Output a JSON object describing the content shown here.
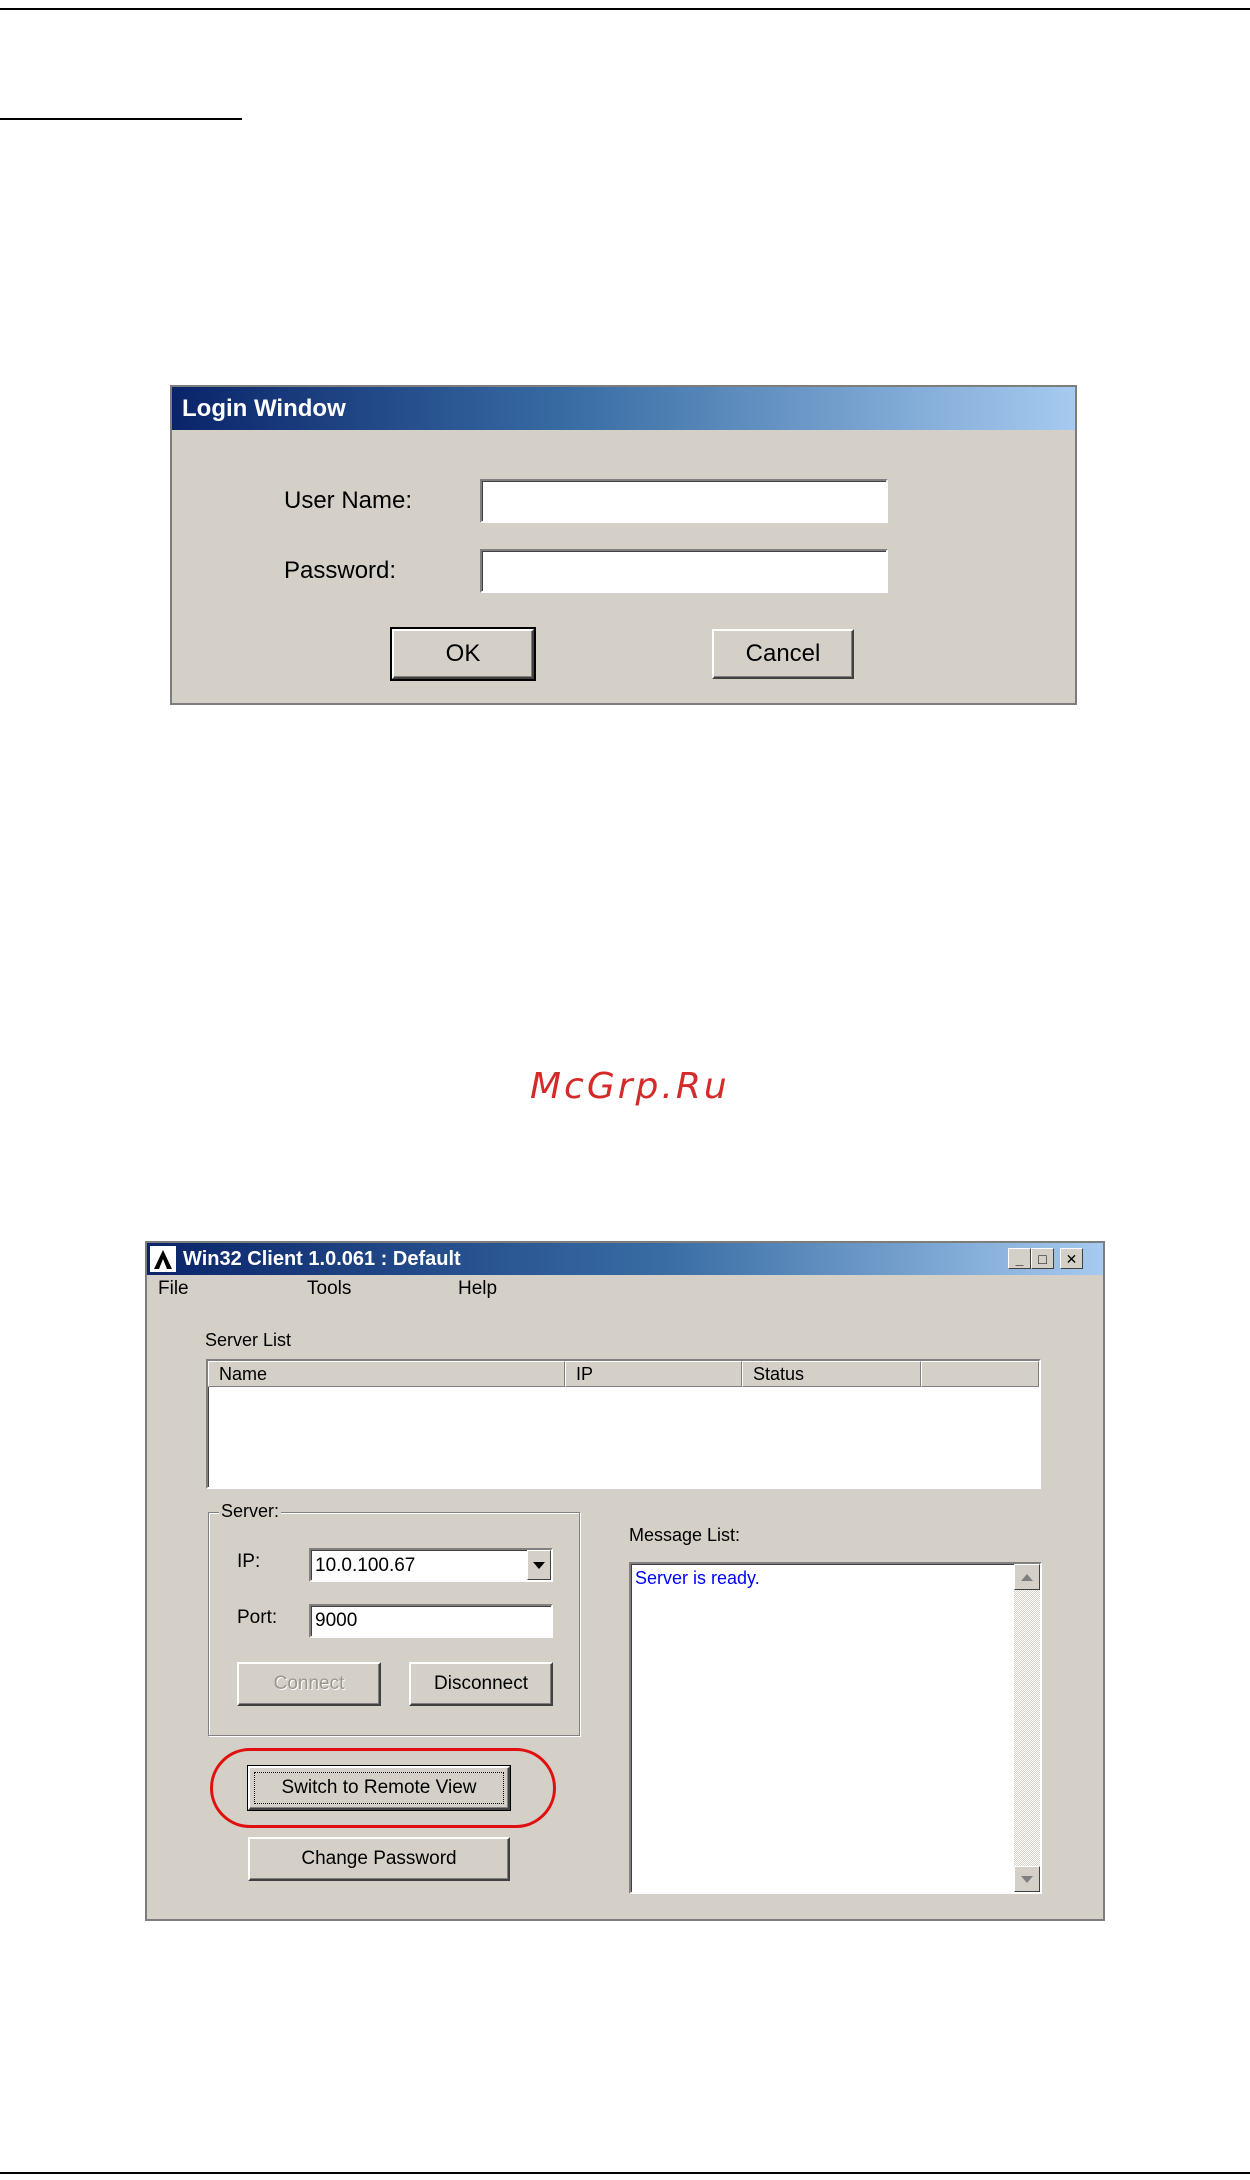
{
  "watermark": "McGrp.Ru",
  "login_window": {
    "title": "Login Window",
    "username_label": "User Name:",
    "username_value": "",
    "password_label": "Password:",
    "password_value": "",
    "ok_label": "OK",
    "cancel_label": "Cancel"
  },
  "client_window": {
    "title": "Win32 Client 1.0.061 : Default",
    "controls": {
      "minimize": "_",
      "maximize": "□",
      "close": "✕"
    },
    "menu": [
      "File",
      "Tools",
      "Help"
    ],
    "server_list": {
      "label": "Server List",
      "columns": [
        "Name",
        "IP",
        "Status",
        ""
      ]
    },
    "server_group": {
      "label": "Server:",
      "ip_label": "IP:",
      "ip_value": "10.0.100.67",
      "port_label": "Port:",
      "port_value": "9000",
      "connect_label": "Connect",
      "disconnect_label": "Disconnect"
    },
    "switch_label": "Switch to Remote View",
    "change_password_label": "Change Password",
    "message_list": {
      "label": "Message List:",
      "messages": [
        "Server is ready."
      ]
    },
    "colors": {
      "message_text": "#0000ff",
      "highlight": "#e01010",
      "title_gradient_start": "#0a246a"
    }
  }
}
